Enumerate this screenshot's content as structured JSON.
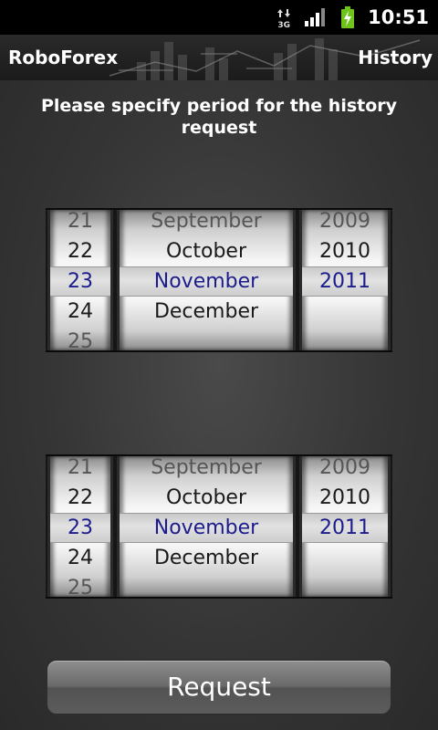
{
  "status_bar": {
    "network": "3G",
    "time": "10:51"
  },
  "header": {
    "app_title": "RoboForex",
    "action": "History"
  },
  "instruction": "Please specify period for the history request",
  "pickers": [
    {
      "name": "start",
      "days": [
        "21",
        "22",
        "23",
        "24",
        "25"
      ],
      "months": [
        "September",
        "October",
        "November",
        "December",
        ""
      ],
      "years": [
        "2009",
        "2010",
        "2011",
        "",
        ""
      ],
      "selected": {
        "day": "23",
        "month": "November",
        "year": "2011"
      }
    },
    {
      "name": "end",
      "days": [
        "21",
        "22",
        "23",
        "24",
        "25"
      ],
      "months": [
        "September",
        "October",
        "November",
        "December",
        ""
      ],
      "years": [
        "2009",
        "2010",
        "2011",
        "",
        ""
      ],
      "selected": {
        "day": "23",
        "month": "November",
        "year": "2011"
      }
    }
  ],
  "request_button": "Request",
  "colors": {
    "selected_text": "#1c1c8c",
    "status_bar": "#000000",
    "battery": "#6fc41b"
  }
}
